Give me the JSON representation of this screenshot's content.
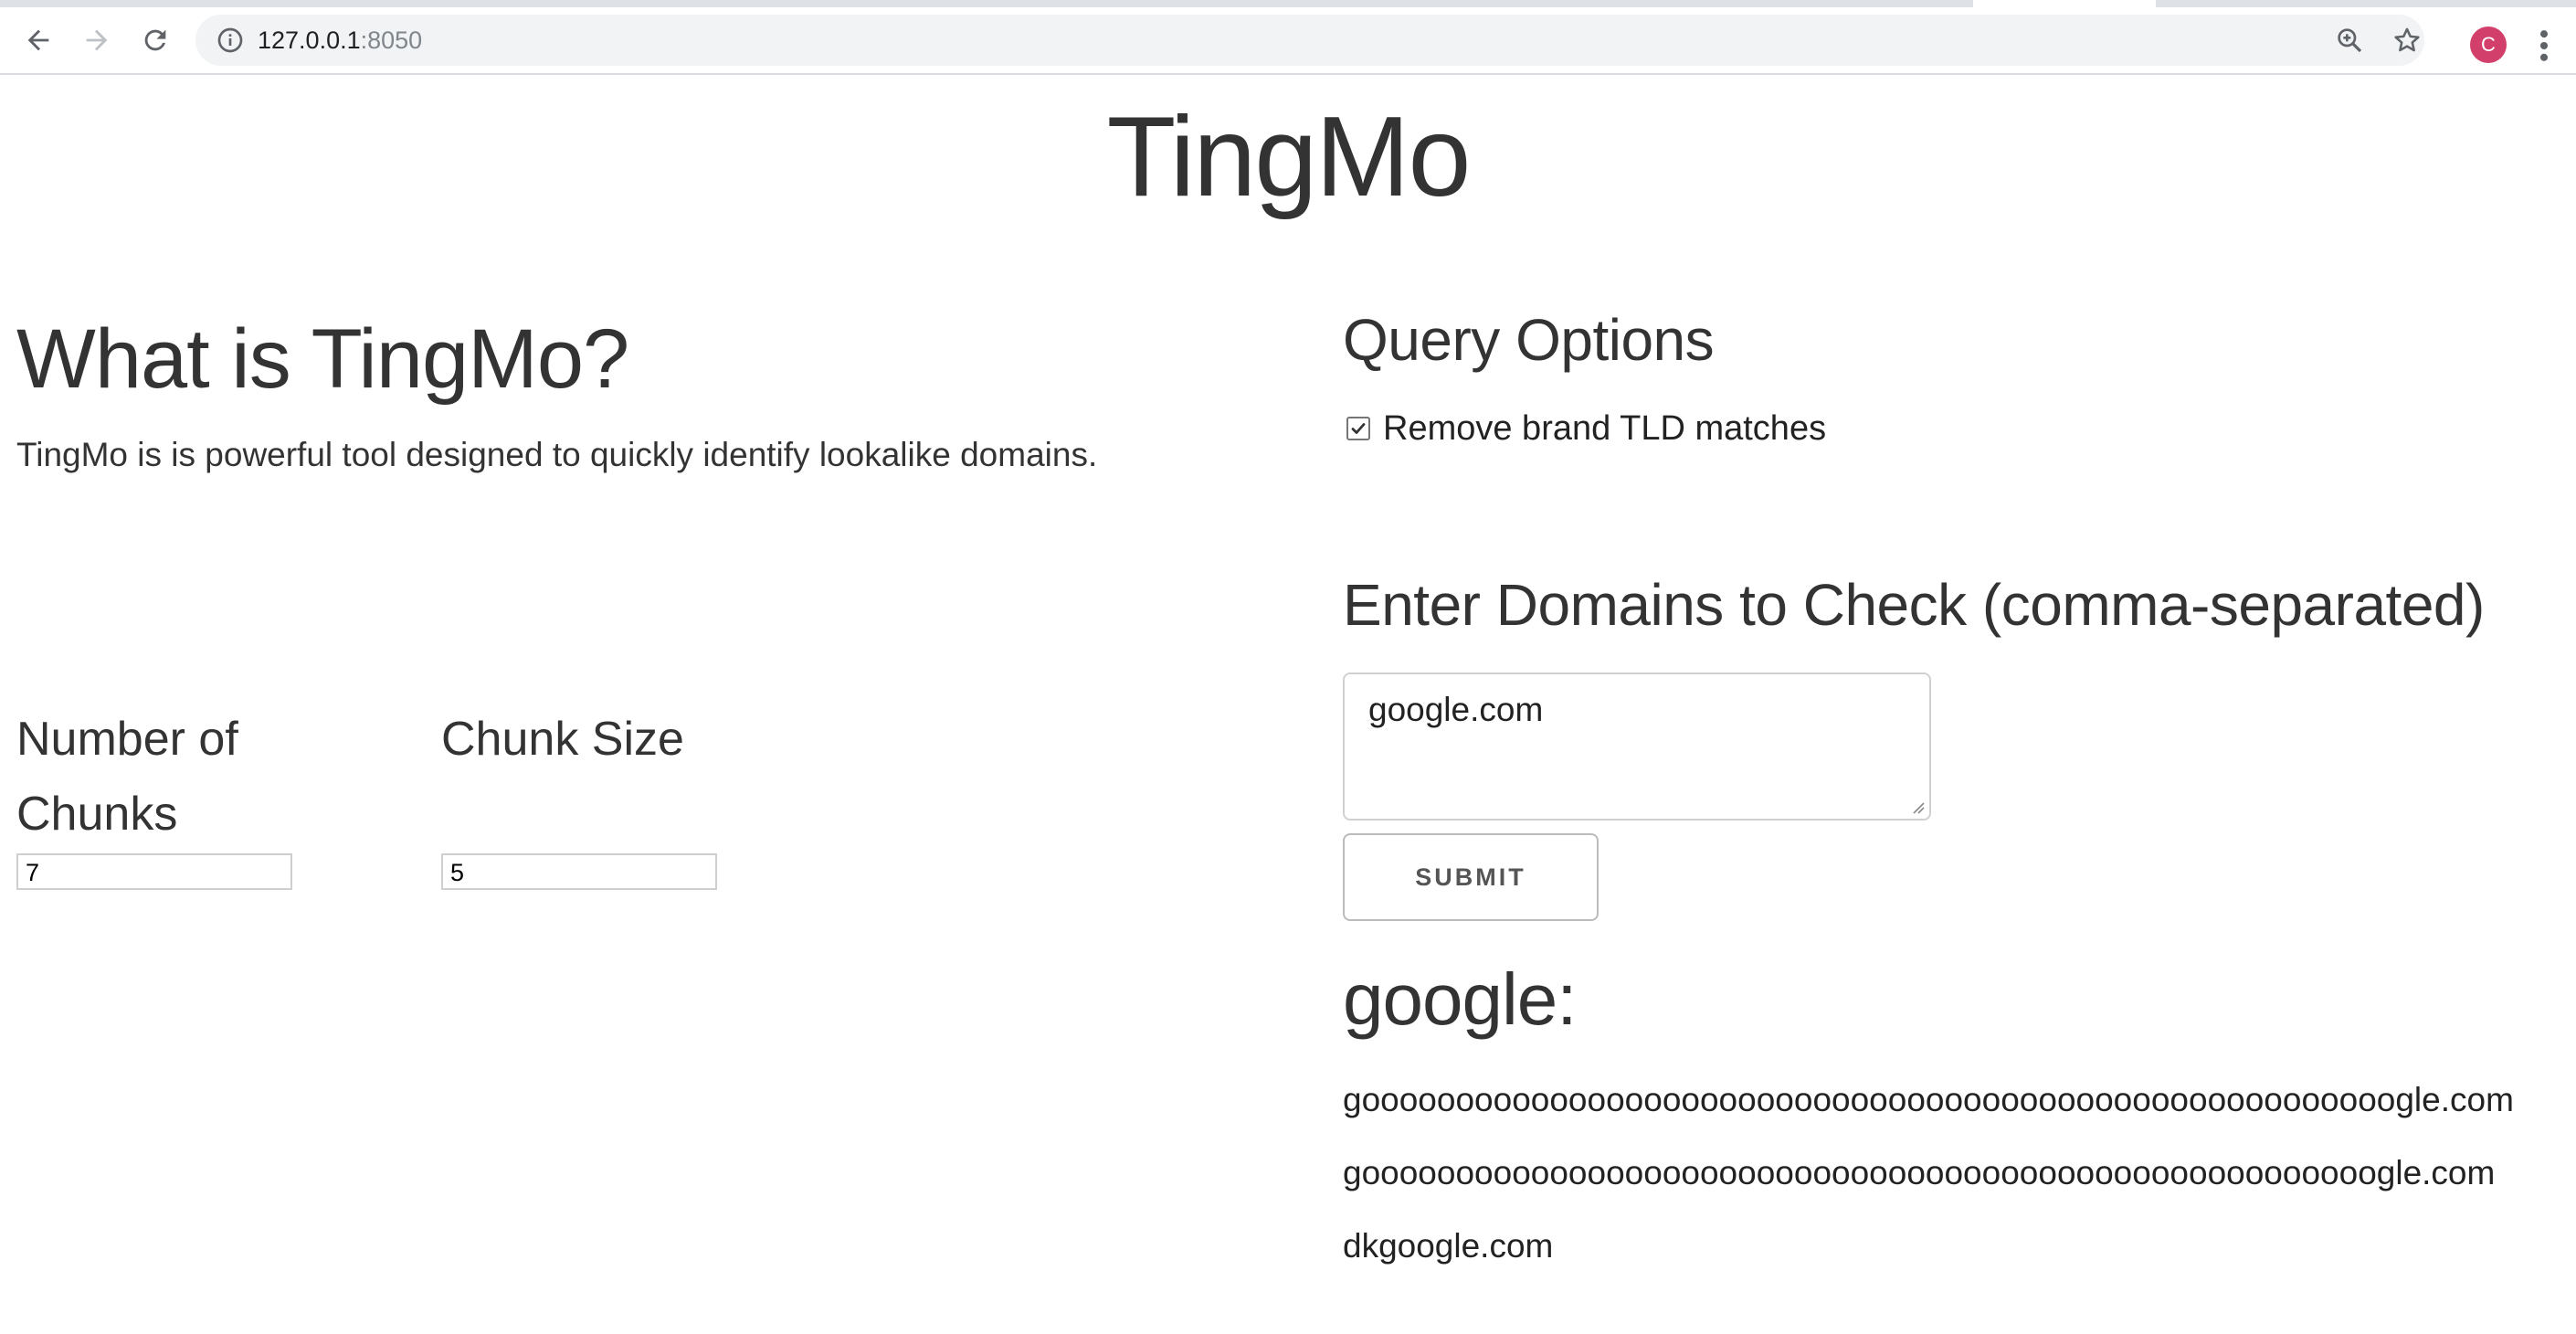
{
  "browser": {
    "url_host": "127.0.0.1",
    "url_port": ":8050",
    "avatar_letter": "C"
  },
  "app": {
    "title": "TingMo"
  },
  "about": {
    "heading": "What is TingMo?",
    "description": "TingMo is is powerful tool designed to quickly identify lookalike domains."
  },
  "params": {
    "chunks_label": "Number of Chunks",
    "chunks_value": "7",
    "chunk_size_label": "Chunk Size",
    "chunk_size_value": "5"
  },
  "query": {
    "heading": "Query Options",
    "remove_tld_label": "Remove brand TLD matches",
    "remove_tld_checked": true,
    "domains_heading": "Enter Domains to Check (comma-separated)",
    "domains_value": "google.com",
    "submit_label": "SUBMIT"
  },
  "results": {
    "heading": "google:",
    "items": [
      "gooooooooooooooooooooooooooooooooooooooooooooooooooooooogle.com",
      "goooooooooooooooooooooooooooooooooooooooooooooooooooooogle.com",
      "dkgoogle.com"
    ]
  },
  "colors": {
    "text": "#333333",
    "avatar": "#d23f6b",
    "omnibox": "#f1f3f4"
  }
}
